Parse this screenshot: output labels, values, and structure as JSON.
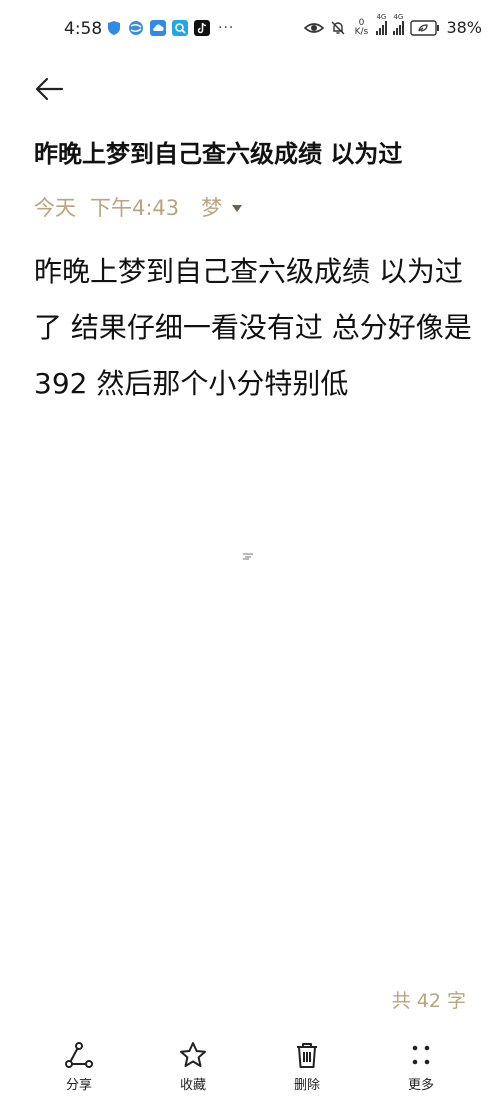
{
  "status_bar": {
    "time": "4:58",
    "speed_value": "0",
    "speed_unit": "K/s",
    "sim1": "4G",
    "sim2": "4G",
    "battery": "38%"
  },
  "note": {
    "title": "昨晚上梦到自己查六级成绩 以为过",
    "date": "今天",
    "time": "下午4:43",
    "folder": "梦",
    "body": "昨晚上梦到自己查六级成绩 以为过了 结果仔细一看没有过 总分好像是392 然后那个小分特别低",
    "word_count": "共 42 字"
  },
  "toolbar": {
    "share": "分享",
    "favorite": "收藏",
    "delete": "删除",
    "more": "更多"
  },
  "colors": {
    "accent": "#b8a57f",
    "text": "#111111",
    "background": "#ffffff"
  }
}
